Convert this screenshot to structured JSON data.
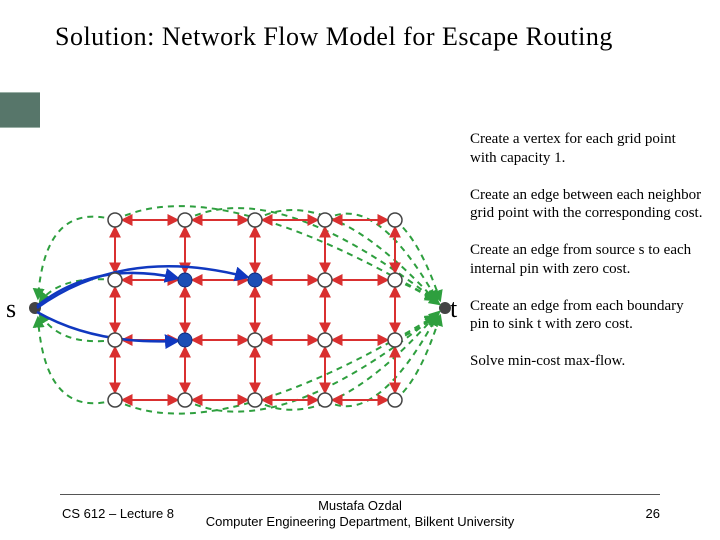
{
  "title": "Solution: Network Flow Model for Escape Routing",
  "steps": {
    "p1": "Create a vertex for each grid point with capacity 1.",
    "p2": "Create an edge between each neighbor grid point with the corresponding cost.",
    "p3": "Create an edge from source s to each internal pin with zero cost.",
    "p4": "Create an edge from each boundary pin to sink t with zero cost.",
    "p5": "Solve min-cost max-flow."
  },
  "labels": {
    "s": "s",
    "t": "t"
  },
  "footer": {
    "left": "CS 612 – Lecture 8",
    "center1": "Mustafa Ozdal",
    "center2": "Computer Engineering Department, Bilkent University",
    "page": "26"
  },
  "chart_data": {
    "type": "diagram",
    "description": "Network-flow escape routing model",
    "grid": {
      "rows": 4,
      "cols": 5
    },
    "source": "s",
    "sink": "t",
    "internal_pins": [
      [
        1,
        1
      ],
      [
        1,
        2
      ],
      [
        2,
        1
      ]
    ],
    "edges": {
      "grid_neighbor": "red, bidirectional, cost = distance",
      "boundary_to_t": "green dashed, cost 0",
      "s_to_internal": "blue, cost 0"
    },
    "colors": {
      "grid_edge": "#d93030",
      "boundary_edge": "#2e9f3e",
      "source_edge": "#1038c0",
      "internal_pin": "#1d4fb5"
    }
  }
}
